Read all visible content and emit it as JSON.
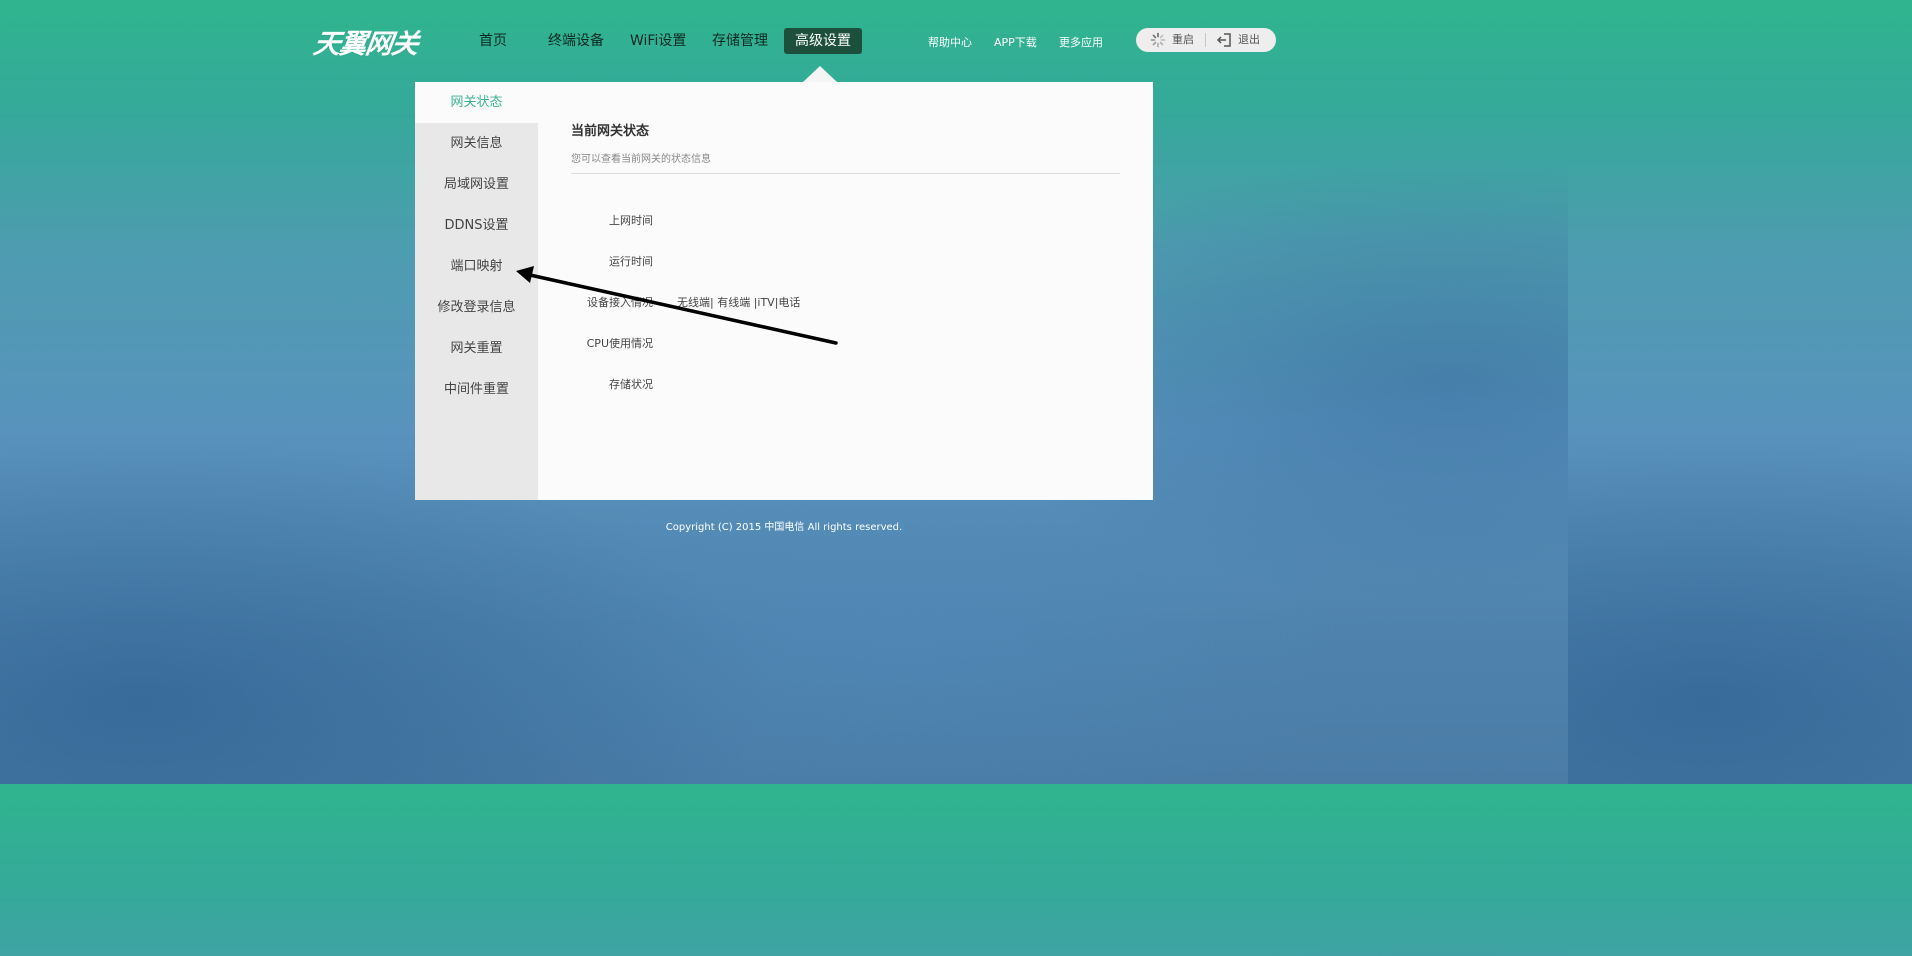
{
  "header": {
    "logo_text": "天翼网关",
    "nav": [
      {
        "label": "首页"
      },
      {
        "label": "终端设备"
      },
      {
        "label": "WiFi设置"
      },
      {
        "label": "存储管理"
      },
      {
        "label": "高级设置",
        "active": true
      }
    ],
    "links": [
      {
        "label": "帮助中心"
      },
      {
        "label": "APP下载"
      },
      {
        "label": "更多应用"
      }
    ],
    "restart_label": "重启",
    "logout_label": "退出"
  },
  "sidebar": {
    "items": [
      {
        "label": "网关状态",
        "active": true
      },
      {
        "label": "网关信息"
      },
      {
        "label": "局域网设置"
      },
      {
        "label": "DDNS设置"
      },
      {
        "label": "端口映射"
      },
      {
        "label": "修改登录信息"
      },
      {
        "label": "网关重置"
      },
      {
        "label": "中间件重置"
      }
    ]
  },
  "content": {
    "title": "当前网关状态",
    "subtitle": "您可以查看当前网关的状态信息",
    "rows": [
      {
        "label": "上网时间",
        "value": ""
      },
      {
        "label": "运行时间",
        "value": ""
      },
      {
        "label": "设备接入情况",
        "value": "无线端| 有线端 |iTV|电话"
      },
      {
        "label": "CPU使用情况",
        "value": ""
      },
      {
        "label": "存储状况",
        "value": ""
      }
    ]
  },
  "footer": {
    "copyright": "Copyright (C) 2015 中国电信 All rights reserved."
  },
  "colors": {
    "accent": "#3cb390",
    "nav_active_bg": "#1c4f3c",
    "sidebar_bg": "#e8e8e8",
    "panel_bg": "#fbfbfb"
  },
  "icons": {
    "restart": "spinner-icon",
    "logout": "logout-icon"
  }
}
